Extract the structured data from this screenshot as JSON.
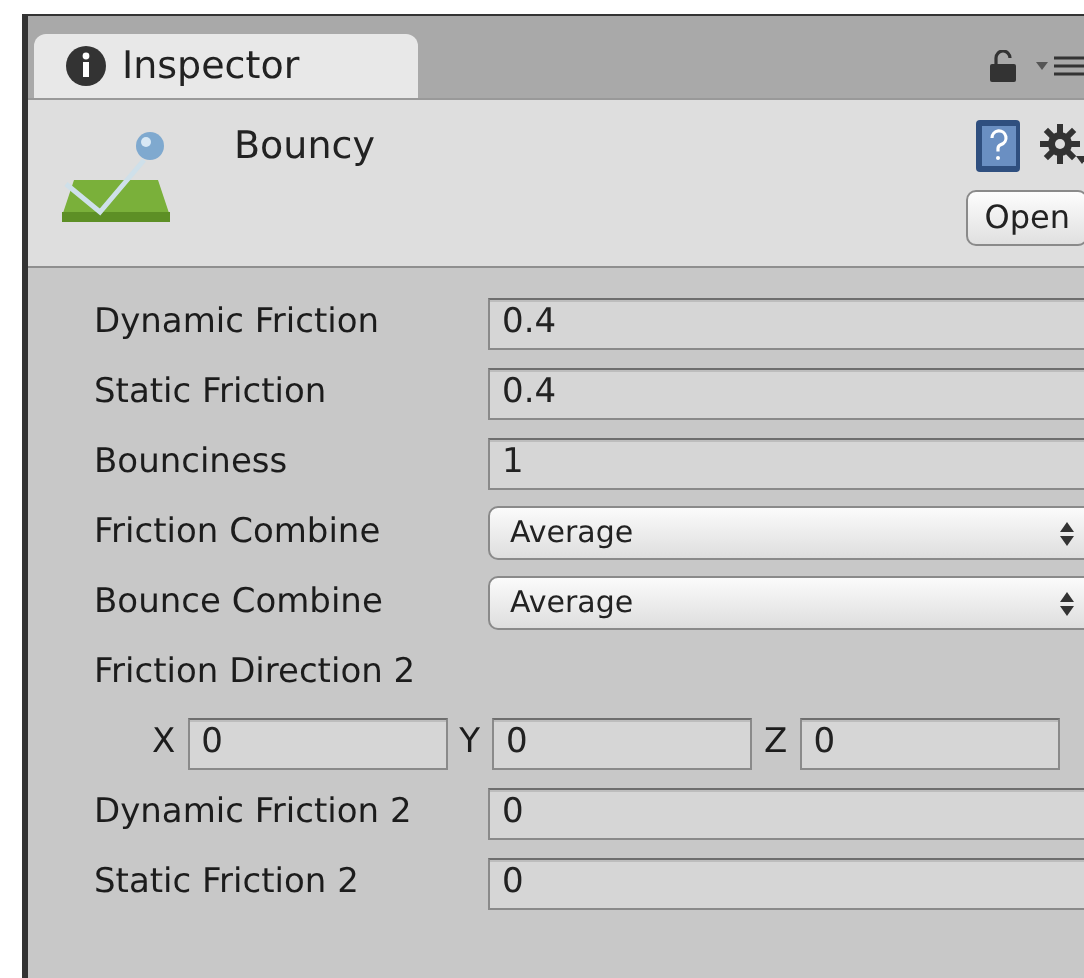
{
  "tab": {
    "label": "Inspector",
    "selected": true
  },
  "header": {
    "title": "Bouncy",
    "open_button": "Open"
  },
  "properties": [
    {
      "kind": "field",
      "label": "Dynamic Friction",
      "value": "0.4"
    },
    {
      "kind": "field",
      "label": "Static Friction",
      "value": "0.4"
    },
    {
      "kind": "field",
      "label": "Bounciness",
      "value": "1"
    },
    {
      "kind": "dropdown",
      "label": "Friction Combine",
      "value": "Average"
    },
    {
      "kind": "dropdown",
      "label": "Bounce Combine",
      "value": "Average"
    },
    {
      "kind": "heading",
      "label": "Friction Direction 2"
    },
    {
      "kind": "vector",
      "components": [
        {
          "axis": "X",
          "value": "0"
        },
        {
          "axis": "Y",
          "value": "0"
        },
        {
          "axis": "Z",
          "value": "0"
        }
      ]
    },
    {
      "kind": "field",
      "label": "Dynamic Friction 2",
      "value": "0"
    },
    {
      "kind": "field",
      "label": "Static Friction 2",
      "value": "0"
    }
  ]
}
